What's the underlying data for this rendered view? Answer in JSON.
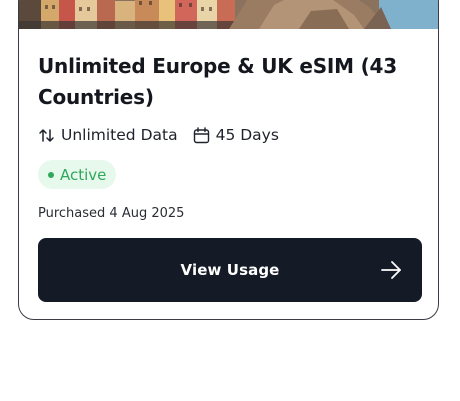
{
  "plan": {
    "title": "Unlimited Europe & UK eSIM (43 Countries)",
    "data_label": "Unlimited Data",
    "data_icon": "arrows-up-down-icon",
    "duration_label": "45 Days",
    "duration_icon": "calendar-icon",
    "status": "Active",
    "status_color": "#2fa85a",
    "purchased": "Purchased 4 Aug 2025"
  },
  "actions": {
    "view_usage_label": "View Usage",
    "view_usage_icon": "arrow-right-icon"
  },
  "colors": {
    "button_bg": "#141a26",
    "badge_bg": "#e7f8ec"
  }
}
